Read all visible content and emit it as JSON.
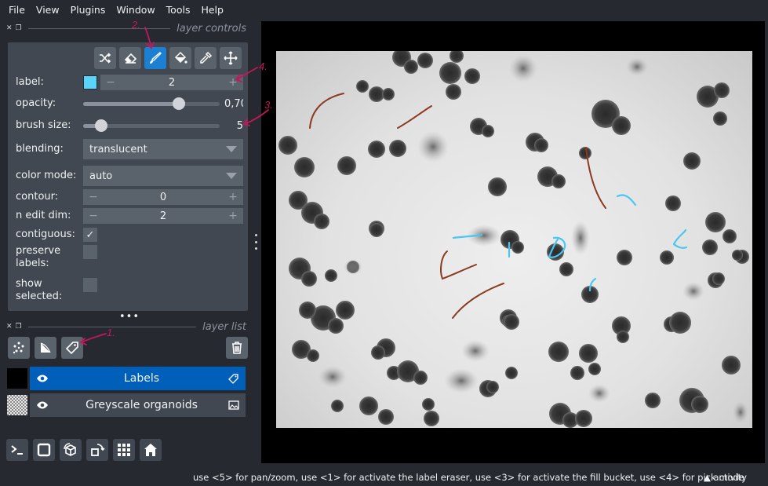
{
  "menu": [
    "File",
    "View",
    "Plugins",
    "Window",
    "Tools",
    "Help"
  ],
  "layer_controls": {
    "title": "layer controls",
    "label": {
      "label": "label:",
      "value": "2",
      "color": "#5ad3fa"
    },
    "opacity": {
      "label": "opacity:",
      "value": "0,70",
      "fraction": 0.7
    },
    "brush_size": {
      "label": "brush size:",
      "value": "5",
      "fraction": 0.13
    },
    "blending": {
      "label": "blending:",
      "value": "translucent"
    },
    "color_mode": {
      "label": "color mode:",
      "value": "auto"
    },
    "contour": {
      "label": "contour:",
      "value": "0"
    },
    "n_edit_dim": {
      "label": "n edit dim:",
      "value": "2"
    },
    "contiguous": {
      "label": "contiguous:",
      "checked": true,
      "mark": "✓"
    },
    "preserve_labels": {
      "label": "preserve labels:",
      "checked": false
    },
    "show_selected": {
      "label": "show selected:",
      "checked": false
    },
    "tools": [
      "shuffle-colors-icon",
      "eraser-icon",
      "paint-brush-icon",
      "fill-bucket-icon",
      "color-picker-icon",
      "pan-zoom-icon"
    ],
    "active_tool": "paint-brush-icon"
  },
  "layer_list": {
    "title": "layer list",
    "layers": [
      {
        "name": "Labels",
        "selected": true,
        "kind": "labels"
      },
      {
        "name": "Greyscale organoids",
        "selected": false,
        "kind": "image"
      }
    ]
  },
  "annotations": [
    "1.",
    "2.",
    "3.",
    "4."
  ],
  "status": {
    "help": "use <5> for pan/zoom, use <1> for activate the label eraser, use <3> for activate the fill bucket, use <4> for pick mode",
    "activity": "activity",
    "activity_arrow": "▲"
  },
  "colors": {
    "accent": "#1c7fd1",
    "selected_layer": "#005fb8",
    "label_2": "#5ad3fa",
    "label_1": "#8b3a1f",
    "annotation": "#c2185b"
  }
}
